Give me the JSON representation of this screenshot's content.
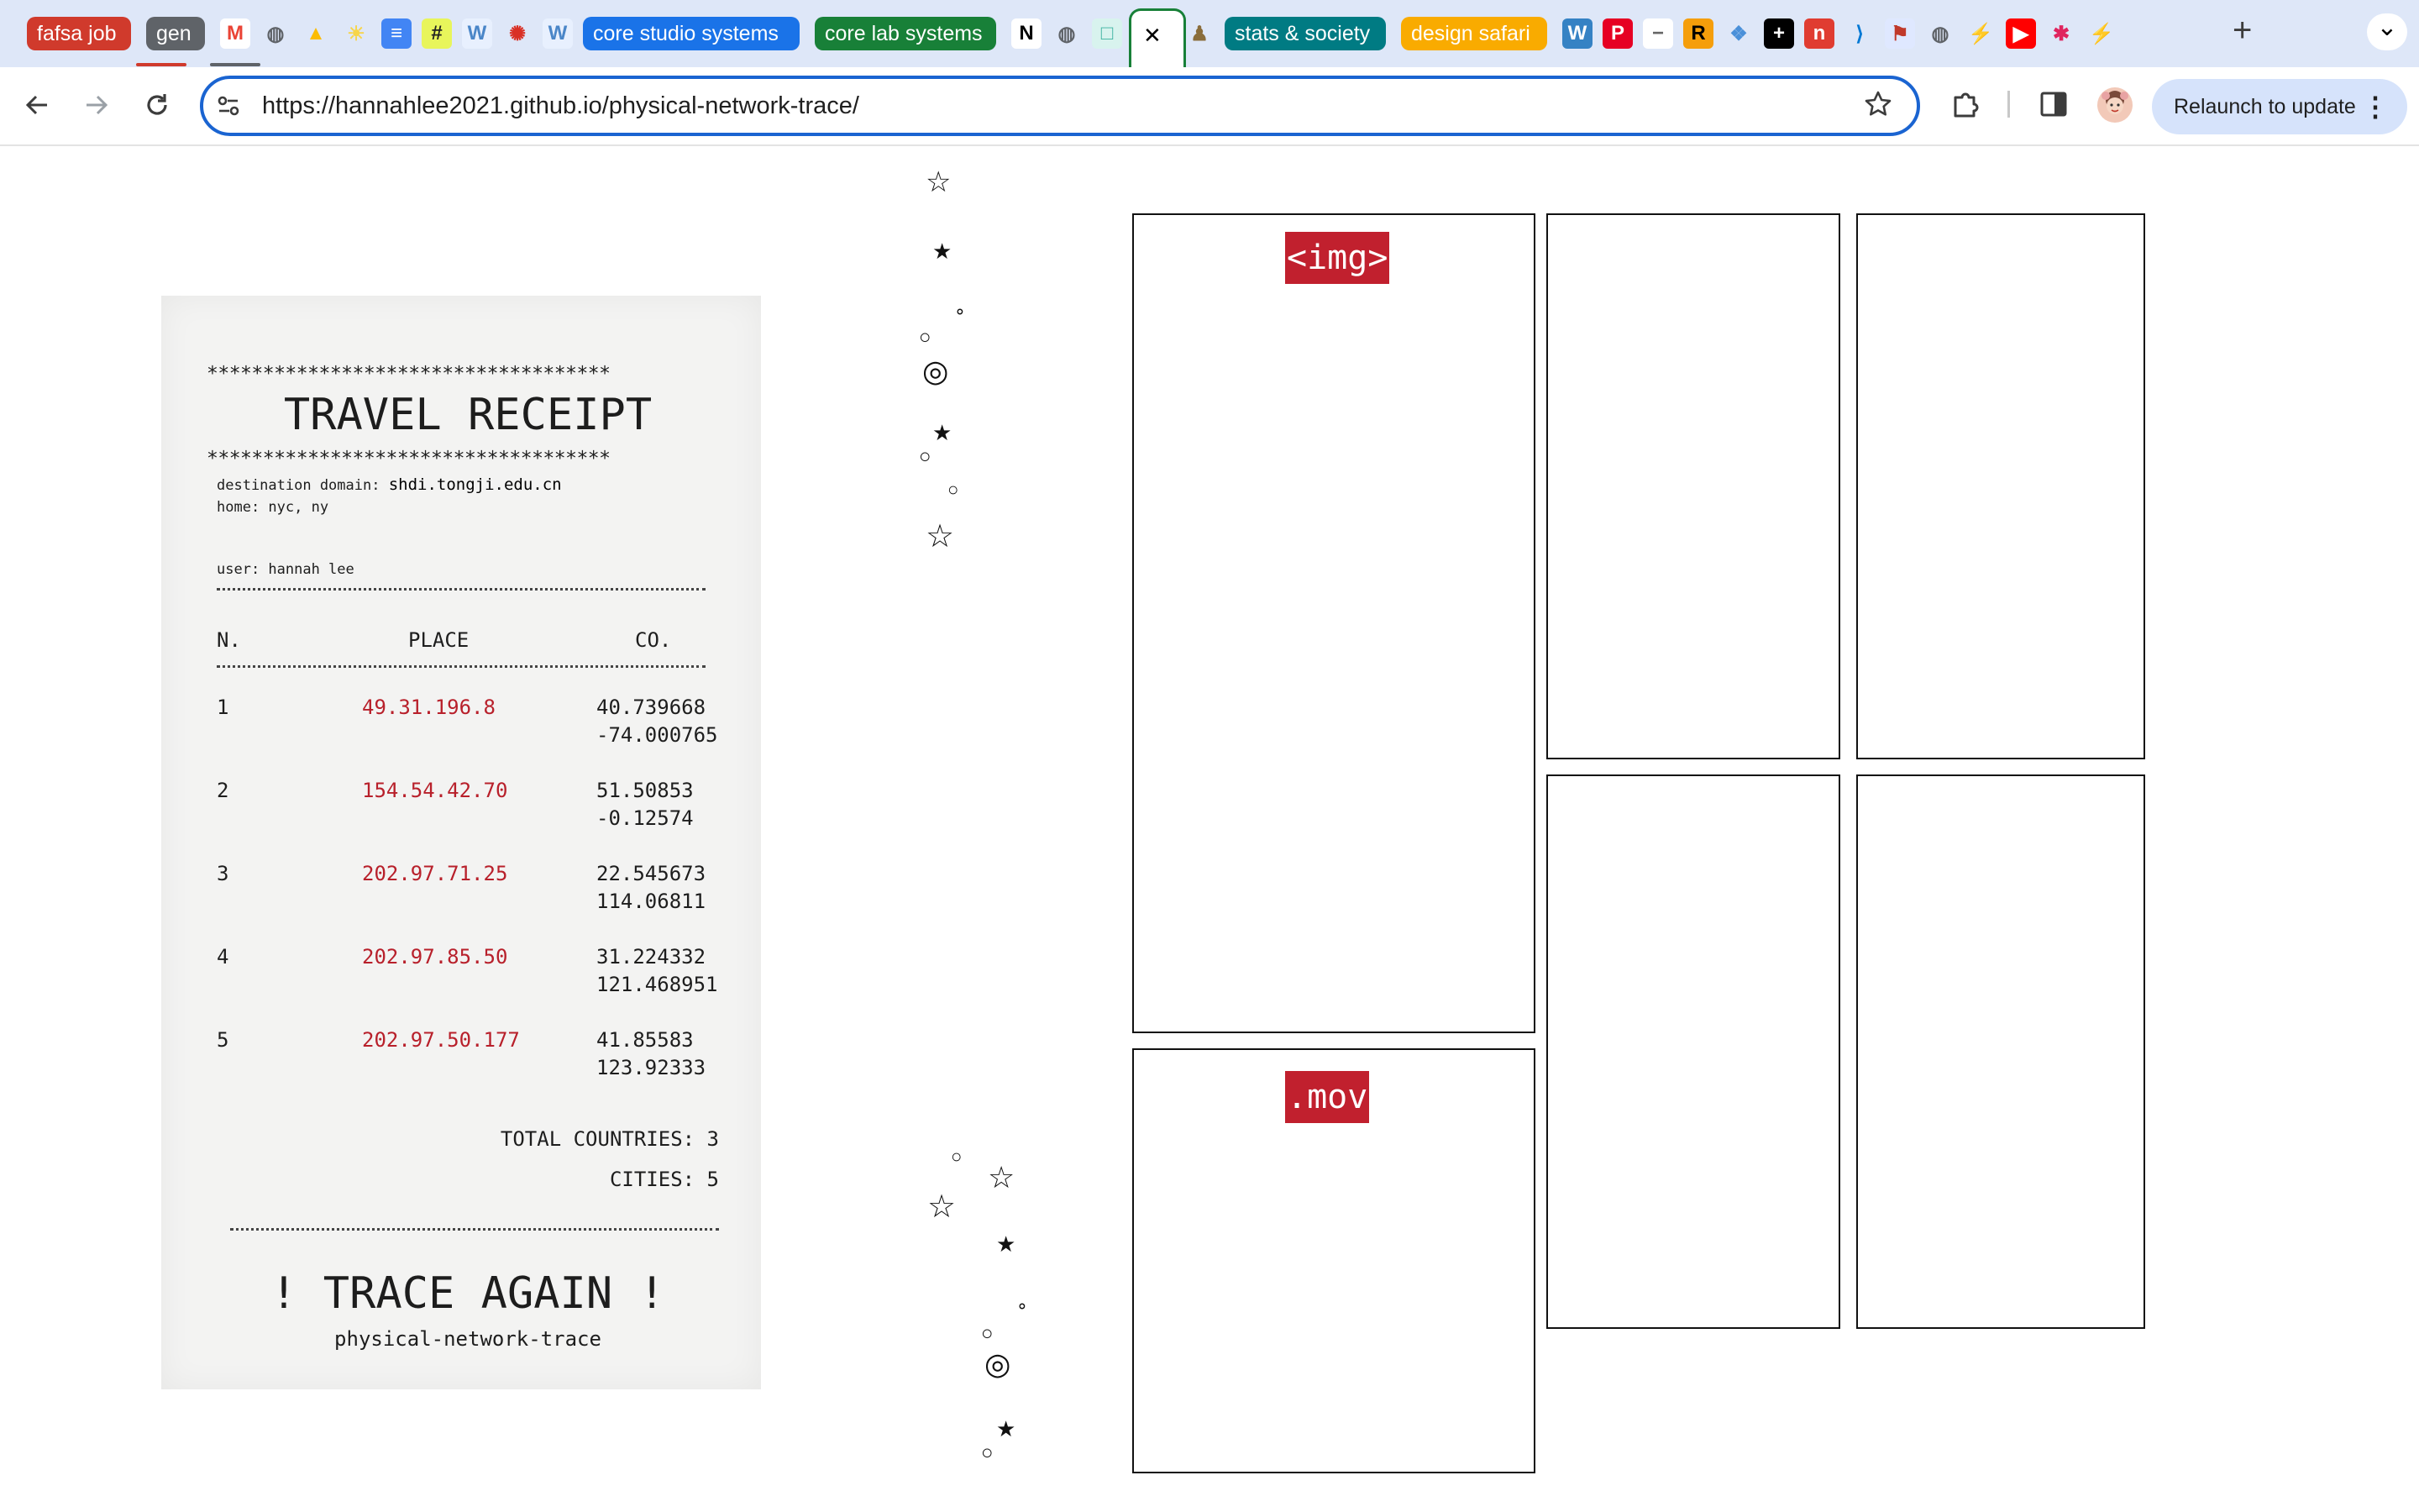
{
  "browser": {
    "tabs": [
      {
        "kind": "group",
        "label": "fafsa job",
        "color": "#d03a2c"
      },
      {
        "kind": "group",
        "label": "gen",
        "color": "#5f6368"
      },
      {
        "kind": "icon",
        "icon": "gmail-icon"
      },
      {
        "kind": "icon",
        "icon": "globe-icon"
      },
      {
        "kind": "icon",
        "icon": "drive-icon"
      },
      {
        "kind": "icon",
        "icon": "sun-icon"
      },
      {
        "kind": "icon",
        "icon": "docs-icon"
      },
      {
        "kind": "icon",
        "icon": "hash-icon"
      },
      {
        "kind": "icon",
        "icon": "w-icon"
      },
      {
        "kind": "icon",
        "icon": "wheel-icon"
      },
      {
        "kind": "icon",
        "icon": "w-icon"
      },
      {
        "kind": "group",
        "label": "core studio systems",
        "color": "#1a73e8"
      },
      {
        "kind": "group",
        "label": "core lab systems",
        "color": "#188038"
      },
      {
        "kind": "icon",
        "icon": "notion-icon"
      },
      {
        "kind": "icon",
        "icon": "globe-icon"
      },
      {
        "kind": "icon",
        "icon": "frame-icon"
      },
      {
        "kind": "active",
        "icon": "close-icon"
      },
      {
        "kind": "icon",
        "icon": "figure-icon"
      },
      {
        "kind": "group",
        "label": "stats & society",
        "color": "#007b83"
      },
      {
        "kind": "group",
        "label": "design safari",
        "color": "#f9ab00"
      },
      {
        "kind": "icon",
        "icon": "wordpress-icon"
      },
      {
        "kind": "icon",
        "icon": "pinterest-icon"
      },
      {
        "kind": "icon",
        "icon": "minus-icon"
      },
      {
        "kind": "icon",
        "icon": "r-icon"
      },
      {
        "kind": "icon",
        "icon": "gem-icon"
      },
      {
        "kind": "icon",
        "icon": "plus-box-icon"
      },
      {
        "kind": "icon",
        "icon": "n-red-icon"
      },
      {
        "kind": "icon",
        "icon": "vscode-icon"
      },
      {
        "kind": "icon",
        "icon": "flag-icon"
      },
      {
        "kind": "icon",
        "icon": "globe-icon"
      },
      {
        "kind": "icon",
        "icon": "bolt-icon"
      },
      {
        "kind": "icon",
        "icon": "youtube-icon"
      },
      {
        "kind": "icon",
        "icon": "asterisk-icon"
      },
      {
        "kind": "icon",
        "icon": "bolt-icon"
      }
    ],
    "new_tab": "+",
    "tab_menu": "⌄",
    "url": "https://hannahlee2021.github.io/physical-network-trace/",
    "relaunch_label": "Relaunch to update",
    "relaunch_menu": "⋮",
    "accent_color": "#1a64d1"
  },
  "receipt": {
    "stars_line": "************************************",
    "title": "TRAVEL RECEIPT",
    "destination_label": "destination domain:",
    "destination_value": "shdi.tongji.edu.cn",
    "home": "home: nyc, ny",
    "user": "user: hannah lee",
    "columns": {
      "n": "N.",
      "place": "PLACE",
      "co": "CO."
    },
    "rows": [
      {
        "n": "1",
        "ip": "49.31.196.8",
        "lat": "40.739668",
        "lon": "-74.000765"
      },
      {
        "n": "2",
        "ip": "154.54.42.70",
        "lat": "51.50853",
        "lon": "-0.12574"
      },
      {
        "n": "3",
        "ip": "202.97.71.25",
        "lat": "22.545673",
        "lon": "114.06811"
      },
      {
        "n": "4",
        "ip": "202.97.85.50",
        "lat": "31.224332",
        "lon": "121.468951"
      },
      {
        "n": "5",
        "ip": "202.97.50.177",
        "lat": "41.85583",
        "lon": "123.92333"
      }
    ],
    "total_countries": "TOTAL COUNTRIES: 3",
    "cities": "CITIES: 5",
    "trace_again": "! TRACE AGAIN !",
    "footer": "physical-network-trace",
    "ip_color": "#b8202b"
  },
  "gallery": {
    "img_tag": "<img>",
    "mov_tag": ".mov",
    "tag_color": "#c1202e"
  }
}
